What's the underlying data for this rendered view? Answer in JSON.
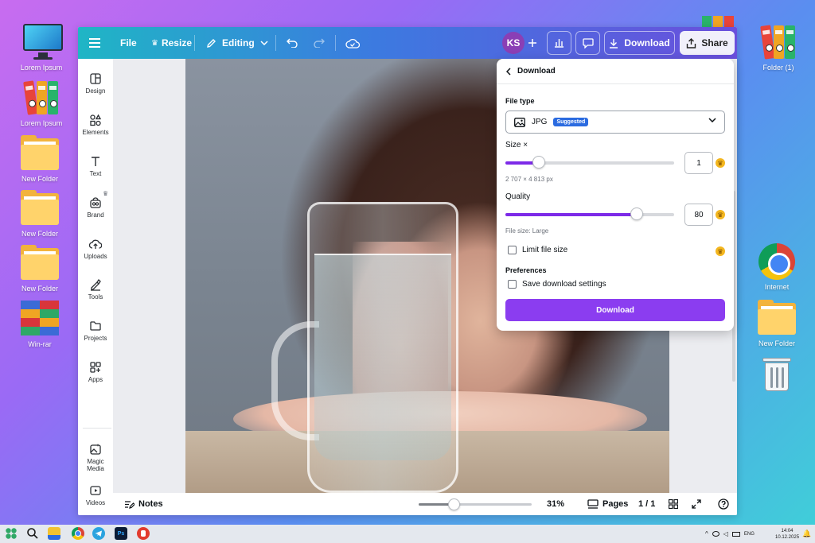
{
  "desktop": {
    "icons_left": [
      {
        "label": "Lorem Ipsum",
        "icon": "monitor-icon"
      },
      {
        "label": "Lorem Ipsum",
        "icon": "binders-icon"
      },
      {
        "label": "New Folder",
        "icon": "folder-icon"
      },
      {
        "label": "New Folder",
        "icon": "folder-icon"
      },
      {
        "label": "New Folder",
        "icon": "folder-icon"
      },
      {
        "label": "Win-rar",
        "icon": "winrar-icon"
      }
    ],
    "icons_right": [
      {
        "label": "Folder (1)",
        "icon": "binders-icon"
      },
      {
        "label": "Internet",
        "icon": "chrome-icon"
      },
      {
        "label": "New Folder",
        "icon": "folder-icon"
      },
      {
        "label": "",
        "icon": "recycle-bin-icon"
      }
    ]
  },
  "topbar": {
    "menu_icon": "hamburger-icon",
    "file": "File",
    "resize": "Resize",
    "editing": "Editing",
    "avatar": "KS",
    "download": "Download",
    "share": "Share"
  },
  "sidebar": {
    "items": [
      {
        "label": "Design",
        "icon": "design-icon"
      },
      {
        "label": "Elements",
        "icon": "elements-icon"
      },
      {
        "label": "Text",
        "icon": "text-icon"
      },
      {
        "label": "Brand",
        "icon": "brand-icon"
      },
      {
        "label": "Uploads",
        "icon": "uploads-icon"
      },
      {
        "label": "Tools",
        "icon": "tools-icon"
      },
      {
        "label": "Projects",
        "icon": "projects-icon"
      },
      {
        "label": "Apps",
        "icon": "apps-icon"
      },
      {
        "label": "Magic Media",
        "icon": "magic-media-icon"
      },
      {
        "label": "Videos",
        "icon": "videos-icon"
      }
    ]
  },
  "bottombar": {
    "notes": "Notes",
    "zoom": "31%",
    "zoom_level": 0.31,
    "pages": "Pages",
    "page_count": "1 / 1"
  },
  "download_panel": {
    "title": "Download",
    "file_type_label": "File type",
    "file_type_value": "JPG",
    "suggested_badge": "Suggested",
    "size_label": "Size ×",
    "size_value": "1",
    "size_fraction": 0.2,
    "dimensions": "2 707 × 4 813 px",
    "quality_label": "Quality",
    "quality_value": "80",
    "quality_fraction": 0.78,
    "file_size": "File size: Large",
    "limit_file_size": "Limit file size",
    "preferences_label": "Preferences",
    "save_settings": "Save download settings",
    "download_button": "Download"
  },
  "taskbar": {
    "lang": "ENG",
    "time": "14:04",
    "date": "10.12.2025"
  },
  "colors": {
    "accent_purple": "#8b3df0",
    "suggested_blue": "#2b6be0",
    "crown_gold": "#f3b61f"
  }
}
